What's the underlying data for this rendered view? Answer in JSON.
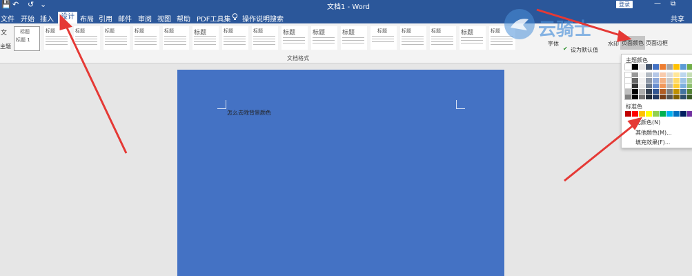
{
  "titlebar": {
    "title": "文档1 - Word",
    "login_label": "登录",
    "undo_icon": "↶",
    "redo_icon": "↺",
    "save_icon": "💾",
    "customize_icon": "⌄",
    "restore_icon": "⧉",
    "minimize_icon": "—"
  },
  "tabs": {
    "file": "文件",
    "home": "开始",
    "insert": "插入",
    "design": "设计",
    "layout": "布局",
    "references": "引用",
    "mailings": "邮件",
    "review": "审阅",
    "view": "视图",
    "help": "帮助",
    "pdf": "PDF工具集",
    "tell_me": "操作说明搜索",
    "share": "共享"
  },
  "ribbon": {
    "group_document_format": "文档格式",
    "theme_letter": "文",
    "theme_label": "主题",
    "style_label_1": "标题",
    "style_title_inner": "标题 1",
    "fonts_label": "字体",
    "set_default_label": "设为默认值",
    "watermark_label": "水印",
    "page_color_label": "页面颜色",
    "page_border_label": "页面边框",
    "style_heading": "标题"
  },
  "document": {
    "text": "怎么去除背景颜色"
  },
  "dropdown": {
    "theme_colors_label": "主题颜色",
    "standard_colors_label": "标准色",
    "no_color": "无颜色(N)",
    "more_colors": "其他颜色(M)...",
    "fill_effects": "填充效果(F)..."
  },
  "theme_colors": [
    "#ffffff",
    "#000000",
    "#e7e6e6",
    "#44546a",
    "#4472c4",
    "#ed7d31",
    "#a5a5a5",
    "#ffc000",
    "#5b9bd5",
    "#70ad47"
  ],
  "standard_colors": [
    "#c00000",
    "#ff0000",
    "#ffc000",
    "#ffff00",
    "#92d050",
    "#00b050",
    "#00b0f0",
    "#0070c0",
    "#002060",
    "#7030a0"
  ],
  "logo_text": "云骑士"
}
